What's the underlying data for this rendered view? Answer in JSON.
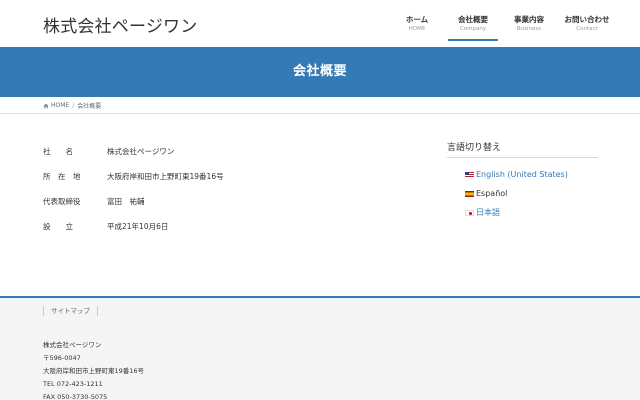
{
  "header": {
    "logo": "株式会社ページワン",
    "nav": [
      {
        "ja": "ホーム",
        "en": "HOME"
      },
      {
        "ja": "会社概要",
        "en": "Company"
      },
      {
        "ja": "事業内容",
        "en": "Business"
      },
      {
        "ja": "お問い合わせ",
        "en": "Contact"
      }
    ]
  },
  "page": {
    "title": "会社概要"
  },
  "breadcrumb": {
    "home": "HOME",
    "separator": "/",
    "current": "会社概要"
  },
  "company": {
    "rows": [
      {
        "label": "社　　名",
        "value": "株式会社ページワン"
      },
      {
        "label": "所　在　地",
        "value": "大阪府岸和田市上野町東19番16号"
      },
      {
        "label": "代表取締役",
        "value": "富田　祐輔"
      },
      {
        "label": "設　　立",
        "value": "平成21年10月6日"
      }
    ]
  },
  "sidebar": {
    "title": "言語切り替え",
    "languages": [
      {
        "label": "English (United States)",
        "flag": "us-flag-icon"
      },
      {
        "label": "Español",
        "flag": "es-flag-icon"
      },
      {
        "label": "日本語",
        "flag": "jp-flag-icon"
      }
    ]
  },
  "footer": {
    "nav_label": "サイトマップ",
    "company_name": "株式会社ページワン",
    "postal": "〒596-0047",
    "address": "大阪府岸和田市上野町東19番16号",
    "tel": "TEL 072-423-1211",
    "fax": "FAX 050-3730-5075"
  },
  "colors": {
    "accent": "#337ab7",
    "footer_bg": "#f5f5f5"
  }
}
